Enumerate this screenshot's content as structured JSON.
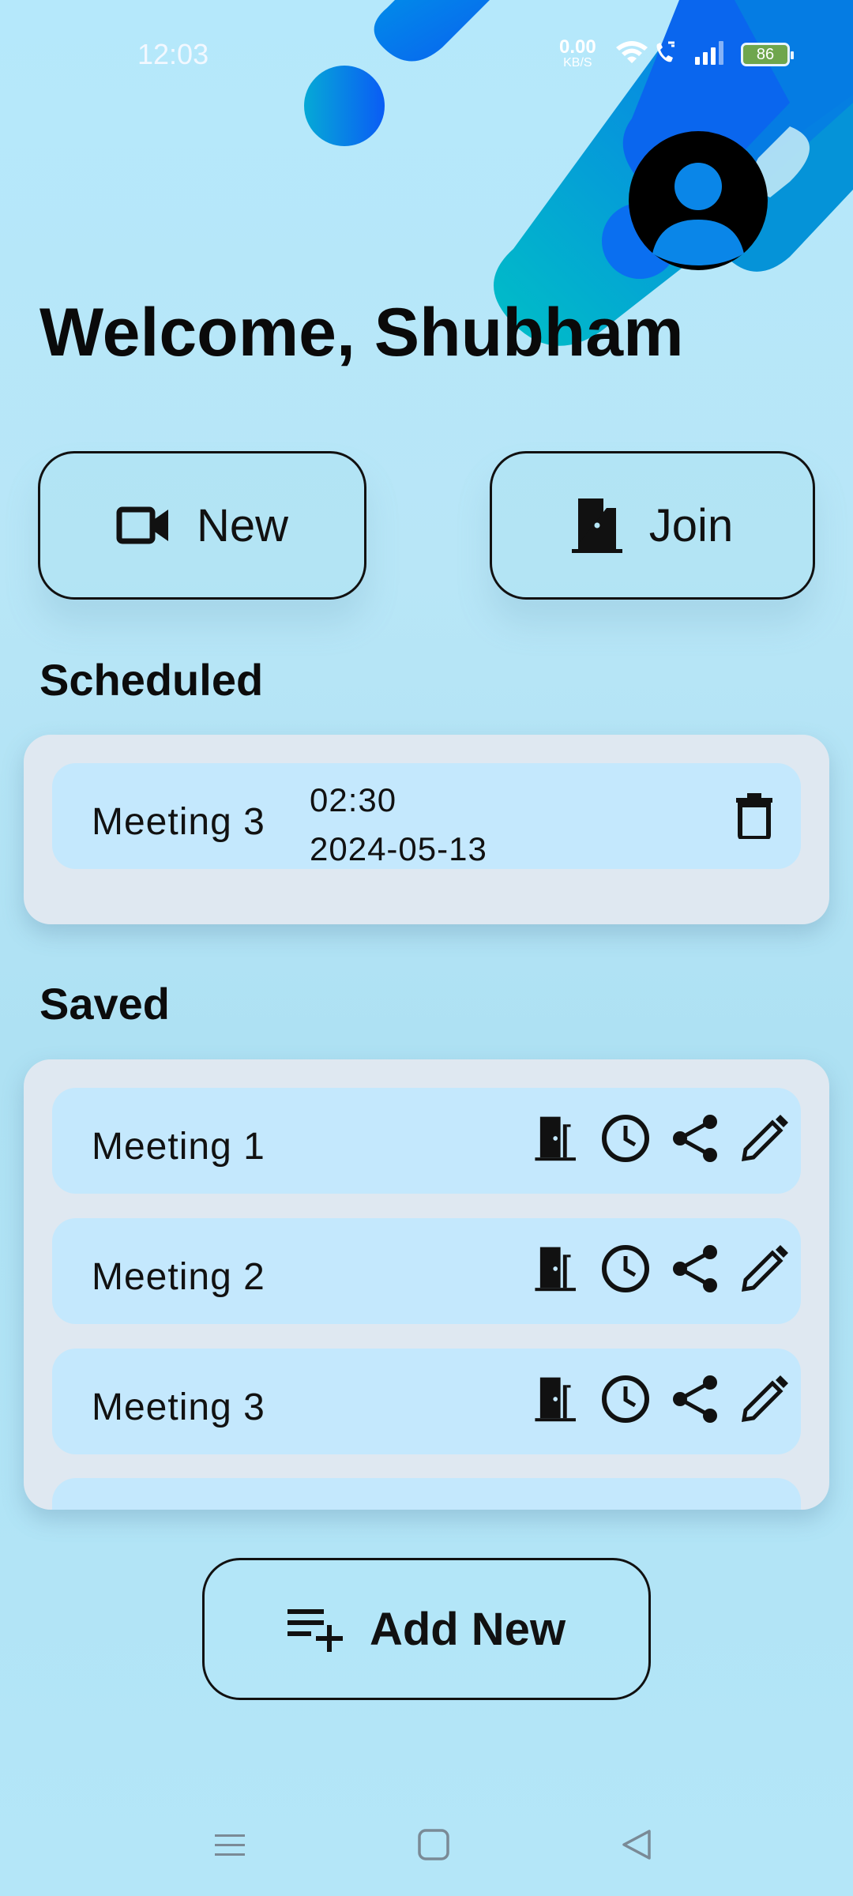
{
  "status_bar": {
    "time": "12:03",
    "net_speed_value": "0.00",
    "net_speed_unit": "KB/S",
    "battery": "86",
    "icons": [
      "wifi-icon",
      "volte-call-icon",
      "signal-icon",
      "battery-icon"
    ]
  },
  "header": {
    "welcome": "Welcome, Shubham",
    "avatar_icon": "account-circle-icon"
  },
  "actions": {
    "new_label": "New",
    "new_icon": "videocam-icon",
    "join_label": "Join",
    "join_icon": "door-icon"
  },
  "scheduled": {
    "title": "Scheduled",
    "items": [
      {
        "name": "Meeting 3",
        "time": "02:30",
        "date": "2024-05-13",
        "icon": "delete-icon"
      }
    ]
  },
  "saved": {
    "title": "Saved",
    "items": [
      {
        "name": "Meeting 1"
      },
      {
        "name": "Meeting 2"
      },
      {
        "name": "Meeting 3"
      }
    ],
    "row_icons": [
      "door-icon",
      "clock-icon",
      "share-icon",
      "edit-icon"
    ]
  },
  "add_new": {
    "label": "Add New",
    "icon": "playlist-add-icon"
  },
  "nav_bar": {
    "icons": [
      "menu-icon",
      "home-square-icon",
      "back-triangle-icon"
    ]
  },
  "colors": {
    "background": "#b5e8fb",
    "card": "#dfe8f1",
    "row": "#c4e8fd",
    "accent_blue": "#0a6ff0",
    "accent_teal": "#00b5c8"
  }
}
